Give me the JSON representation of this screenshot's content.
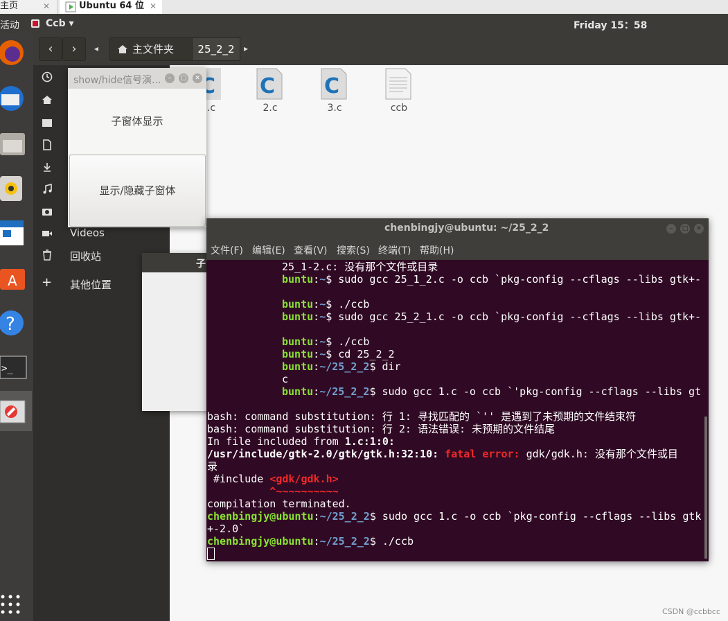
{
  "vmware": {
    "tabs": [
      {
        "label": "主页",
        "close": "✕"
      },
      {
        "label": "Ubuntu 64 位",
        "close": "✕"
      }
    ]
  },
  "top_panel": {
    "activities": "活动",
    "app_menu": "Ccb ▾",
    "clock": "Friday 15：58"
  },
  "nautilus": {
    "path": {
      "home": "主文件夹",
      "current": "25_2_2"
    },
    "sidebar_items": [
      "Videos",
      "回收站",
      "其他位置"
    ],
    "files": [
      {
        "name": ".c",
        "icon": "c-source-file-icon"
      },
      {
        "name": "2.c",
        "icon": "c-source-file-icon"
      },
      {
        "name": "3.c",
        "icon": "c-source-file-icon"
      },
      {
        "name": "ccb",
        "icon": "text-file-icon"
      }
    ]
  },
  "main_window": {
    "title": "show/hide信号演...",
    "show_child_label": "子窗体显示",
    "toggle_button": "显示/隐藏子窗体"
  },
  "child_window": {
    "title": "子窗体"
  },
  "terminal": {
    "title": "chenbingjy@ubuntu: ~/25_2_2",
    "menu": [
      "文件(F)",
      "编辑(E)",
      "查看(V)",
      "搜索(S)",
      "终端(T)",
      "帮助(H)"
    ],
    "prompt_user": "chenbingjy@ubuntu",
    "partial_user": "buntu",
    "lines": {
      "l1": "25_1-2.c: 没有那个文件或目录",
      "l2_path": "~",
      "l2_cmd": "$ sudo gcc 25_1_2.c -o ccb `pkg-config --cflags --libs gtk+-",
      "l3_path": "~",
      "l3_cmd": "$ ./ccb",
      "l4_path": "~",
      "l4_cmd": "$ sudo gcc 25_2_1.c -o ccb `pkg-config --cflags --libs gtk+-",
      "l5_path": "~",
      "l5_cmd": "$ ./ccb",
      "l6_path": "~",
      "l6_cmd": "$ cd 25_2_2",
      "l7_path": "~/25_2_2",
      "l7_cmd": "$ dir",
      "l8": "c",
      "l9_path": "~/25_2_2",
      "l9_cmd": "$ sudo gcc 1.c -o ccb `'pkg-config --cflags --libs gt",
      "l10": "bash: command substitution: 行 1: 寻找匹配的 `'' 是遇到了未预期的文件结束符",
      "l11": "bash: command substitution: 行 2: 语法错误: 未预期的文件结尾",
      "l12_a": "In file included from ",
      "l12_b": "1.c:1:0:",
      "l13_a": "/usr/include/gtk-2.0/gtk/gtk.h:32:10: ",
      "l13_b": "fatal error: ",
      "l13_c": "gdk/gdk.h: 没有那个文件或目",
      "l14": "录",
      "l15_a": " #include ",
      "l15_b": "<gdk/gdk.h>",
      "l16": "          ^~~~~~~~~~~",
      "l17": "compilation terminated.",
      "l18_path": "~/25_2_2",
      "l18_cmd": "$ sudo gcc 1.c -o ccb `pkg-config --cflags --libs gtk",
      "l19": "+-2.0`",
      "l20_path": "~/25_2_2",
      "l20_cmd": "$ ./ccb"
    }
  },
  "watermark": "CSDN @ccbbcc"
}
